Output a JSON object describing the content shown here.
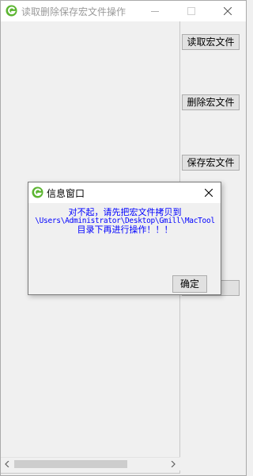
{
  "window": {
    "title": "读取删除保存宏文件操作",
    "icon": "app-logo-icon",
    "controls": [
      "minimize-icon",
      "maximize-icon",
      "close-icon"
    ]
  },
  "buttons": {
    "read": "读取宏文件",
    "delete": "删除宏文件",
    "save": "保存宏文件",
    "fourth": ""
  },
  "dialog": {
    "title": "信息窗口",
    "message_line1": "对不起，请先把宏文件拷贝到",
    "message_line2": "\\Users\\Administrator\\Desktop\\Gmill\\MacTool",
    "message_line3": "目录下再进行操作！！！",
    "ok": "确定",
    "message_color": "#0000ff"
  },
  "scrollbar": {
    "horizontal_thumb_fraction": 0.63
  },
  "colors": {
    "brand_green": "#5cb531",
    "title_text": "#9a9a9a",
    "background": "#f0f0f0"
  }
}
